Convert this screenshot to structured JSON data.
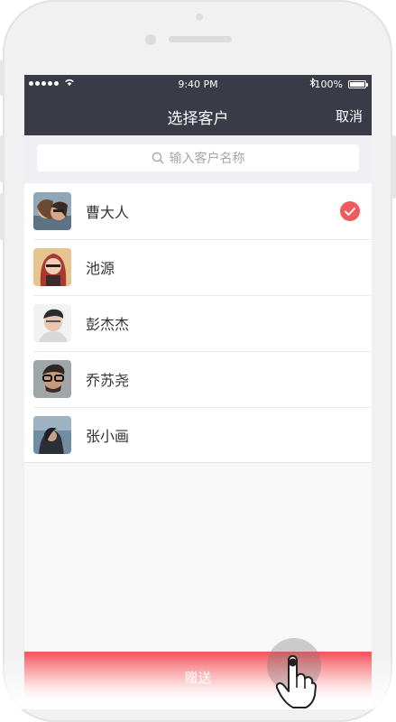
{
  "status_bar": {
    "time": "9:40 PM",
    "battery": "100%"
  },
  "nav": {
    "title": "选择客户",
    "cancel": "取消"
  },
  "search": {
    "placeholder": "输入客户名称"
  },
  "customers": [
    {
      "name": "曹大人",
      "selected": true
    },
    {
      "name": "池源",
      "selected": false
    },
    {
      "name": "彭杰杰",
      "selected": false
    },
    {
      "name": "乔苏尧",
      "selected": false
    },
    {
      "name": "张小画",
      "selected": false
    }
  ],
  "footer": {
    "gift_label": "赠送"
  },
  "colors": {
    "nav_bg": "#3b3b48",
    "accent": "#f05a5f"
  }
}
